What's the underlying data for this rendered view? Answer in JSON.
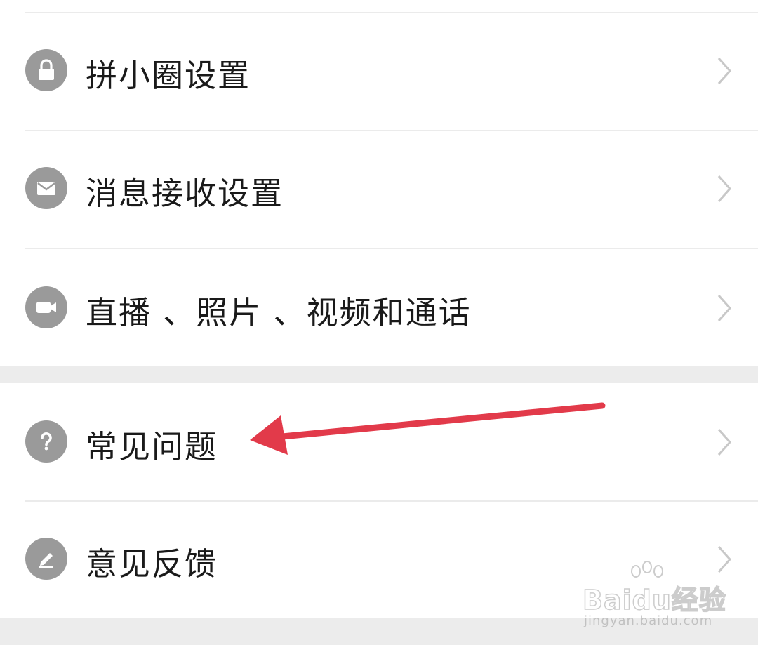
{
  "settings": {
    "items": [
      {
        "label": "拼小圈设置",
        "icon": "lock-icon"
      },
      {
        "label": "消息接收设置",
        "icon": "mail-icon"
      },
      {
        "label": "直播 、照片 、视频和通话",
        "icon": "video-camera-icon"
      },
      {
        "label": "常见问题",
        "icon": "question-icon"
      },
      {
        "label": "意见反馈",
        "icon": "edit-pencil-icon"
      }
    ]
  },
  "watermark": {
    "brand": "Baidu经验",
    "url": "jingyan.baidu.com"
  },
  "colors": {
    "icon_bg": "#9a9a9a",
    "divider": "#ebebeb",
    "section_gap": "#ececec",
    "arrow": "#e23a4a",
    "chevron": "#c8c8c8"
  }
}
